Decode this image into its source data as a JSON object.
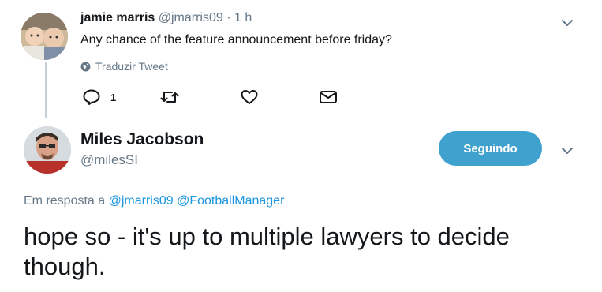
{
  "tweet1": {
    "name": "jamie marris",
    "handle": "@jmarris09",
    "time": "· 1 h",
    "text": "Any chance of the feature announcement before friday?",
    "translate_label": "Traduzir Tweet",
    "reply_count": "1",
    "icons": [
      "chevron-down-icon",
      "globe-icon",
      "reply-icon",
      "retweet-icon",
      "like-icon",
      "message-icon"
    ]
  },
  "tweet2": {
    "name": "Miles Jacobson",
    "handle": "@milesSI",
    "follow_label": "Seguindo",
    "reply_prefix": "Em resposta a",
    "reply_mentions": [
      "@jmarris09",
      "@FootballManager"
    ],
    "text": "hope so - it's up to multiple lawyers to decide though.",
    "icons": [
      "chevron-down-icon"
    ]
  },
  "colors": {
    "accent": "#1b95e0",
    "follow_button": "#3fa1ce",
    "secondary_text": "#657786",
    "thread_line": "#c4cfd6"
  }
}
